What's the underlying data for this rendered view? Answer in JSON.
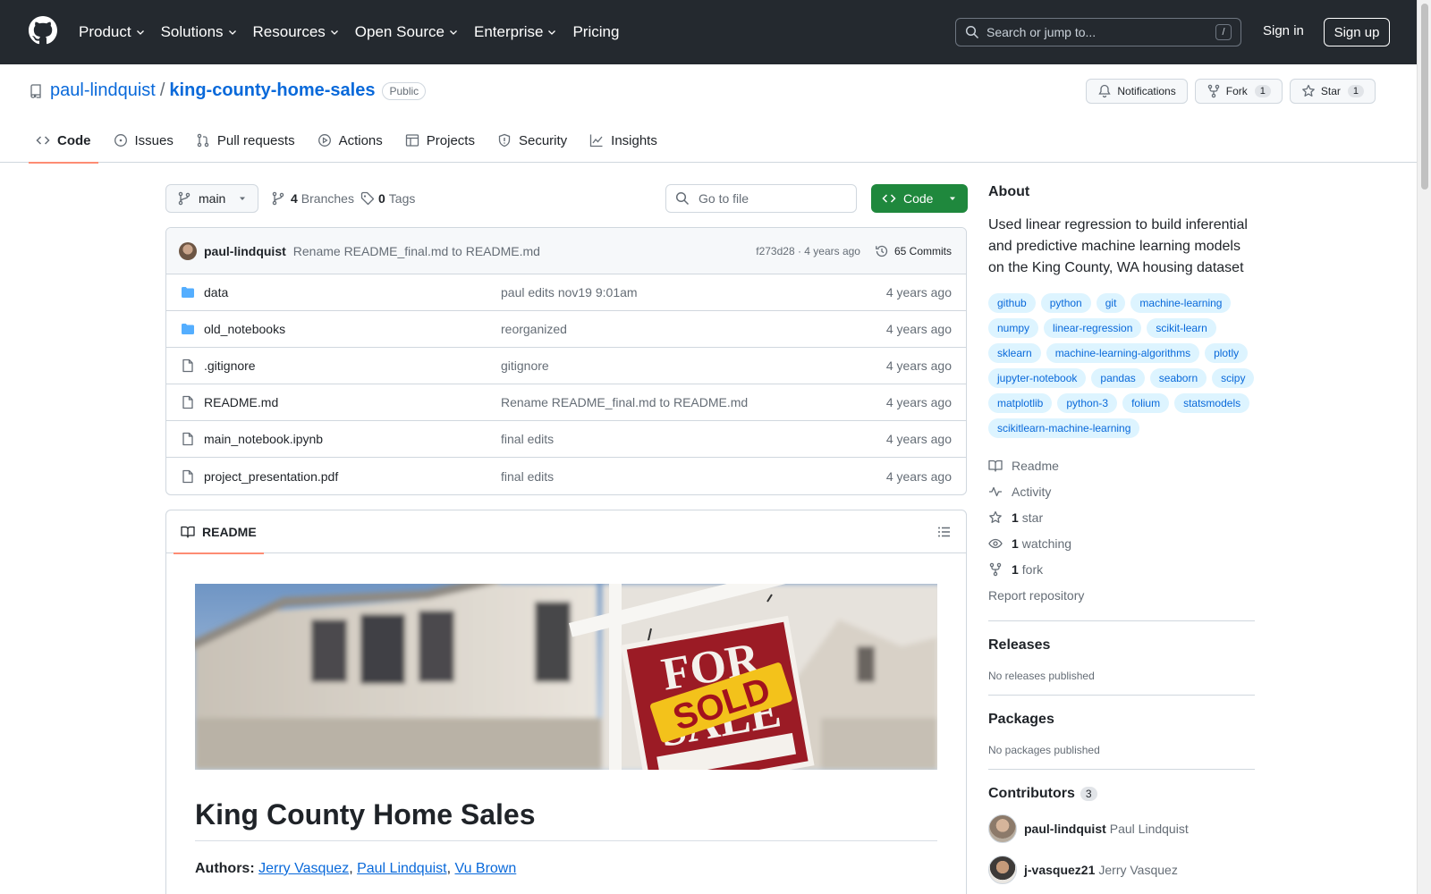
{
  "nav": {
    "items": [
      "Product",
      "Solutions",
      "Resources",
      "Open Source",
      "Enterprise",
      "Pricing"
    ],
    "search_placeholder": "Search or jump to...",
    "search_key": "/",
    "signin": "Sign in",
    "signup": "Sign up"
  },
  "repo": {
    "owner": "paul-lindquist",
    "separator": "/",
    "name": "king-county-home-sales",
    "visibility": "Public",
    "notifications_label": "Notifications",
    "fork_label": "Fork",
    "fork_count": "1",
    "star_label": "Star",
    "star_count": "1"
  },
  "tabs": [
    "Code",
    "Issues",
    "Pull requests",
    "Actions",
    "Projects",
    "Security",
    "Insights"
  ],
  "toolbar": {
    "branch": "main",
    "branches_count": "4",
    "branches_label": "Branches",
    "tags_count": "0",
    "tags_label": "Tags",
    "goto_placeholder": "Go to file",
    "code_label": "Code"
  },
  "commit": {
    "author": "paul-lindquist",
    "message": "Rename README_final.md to README.md",
    "meta": "f273d28 · 4 years ago",
    "commits": "65 Commits"
  },
  "files": [
    {
      "name": "data",
      "type": "folder",
      "message": "paul edits nov19 9:01am",
      "date": "4 years ago"
    },
    {
      "name": "old_notebooks",
      "type": "folder",
      "message": "reorganized",
      "date": "4 years ago"
    },
    {
      "name": ".gitignore",
      "type": "file",
      "message": "gitignore",
      "date": "4 years ago"
    },
    {
      "name": "README.md",
      "type": "file",
      "message": "Rename README_final.md to README.md",
      "date": "4 years ago"
    },
    {
      "name": "main_notebook.ipynb",
      "type": "file",
      "message": "final edits",
      "date": "4 years ago"
    },
    {
      "name": "project_presentation.pdf",
      "type": "file",
      "message": "final edits",
      "date": "4 years ago"
    }
  ],
  "readme": {
    "tab_label": "README",
    "sign_top": "FOR",
    "sign_sold": "SOLD",
    "sign_bottom": "SALE",
    "title": "King County Home Sales",
    "authors_label": "Authors:",
    "authors": [
      "Jerry Vasquez",
      "Paul Lindquist",
      "Vu Brown"
    ],
    "author_sep": ", "
  },
  "about": {
    "heading": "About",
    "description": "Used linear regression to build inferential and predictive machine learning models on the King County, WA housing dataset",
    "topics": [
      "github",
      "python",
      "git",
      "machine-learning",
      "numpy",
      "linear-regression",
      "scikit-learn",
      "sklearn",
      "machine-learning-algorithms",
      "plotly",
      "jupyter-notebook",
      "pandas",
      "seaborn",
      "scipy",
      "matplotlib",
      "python-3",
      "folium",
      "statsmodels",
      "scikitlearn-machine-learning"
    ],
    "readme_link": "Readme",
    "activity_link": "Activity",
    "stars_count": "1",
    "stars_label": "star",
    "watching_count": "1",
    "watching_label": "watching",
    "forks_count": "1",
    "forks_label": "fork",
    "report": "Report repository"
  },
  "releases": {
    "heading": "Releases",
    "text": "No releases published"
  },
  "packages": {
    "heading": "Packages",
    "text": "No packages published"
  },
  "contributors": {
    "heading": "Contributors",
    "count": "3",
    "list": [
      {
        "login": "paul-lindquist",
        "name": "Paul Lindquist"
      },
      {
        "login": "j-vasquez21",
        "name": "Jerry Vasquez"
      }
    ]
  },
  "colors": {
    "header_bg": "#24292f",
    "link": "#0969da",
    "primary_button": "#1f883d",
    "topic_bg": "#ddf4ff",
    "tab_underline": "#fd8c73",
    "folder": "#54aeff"
  }
}
